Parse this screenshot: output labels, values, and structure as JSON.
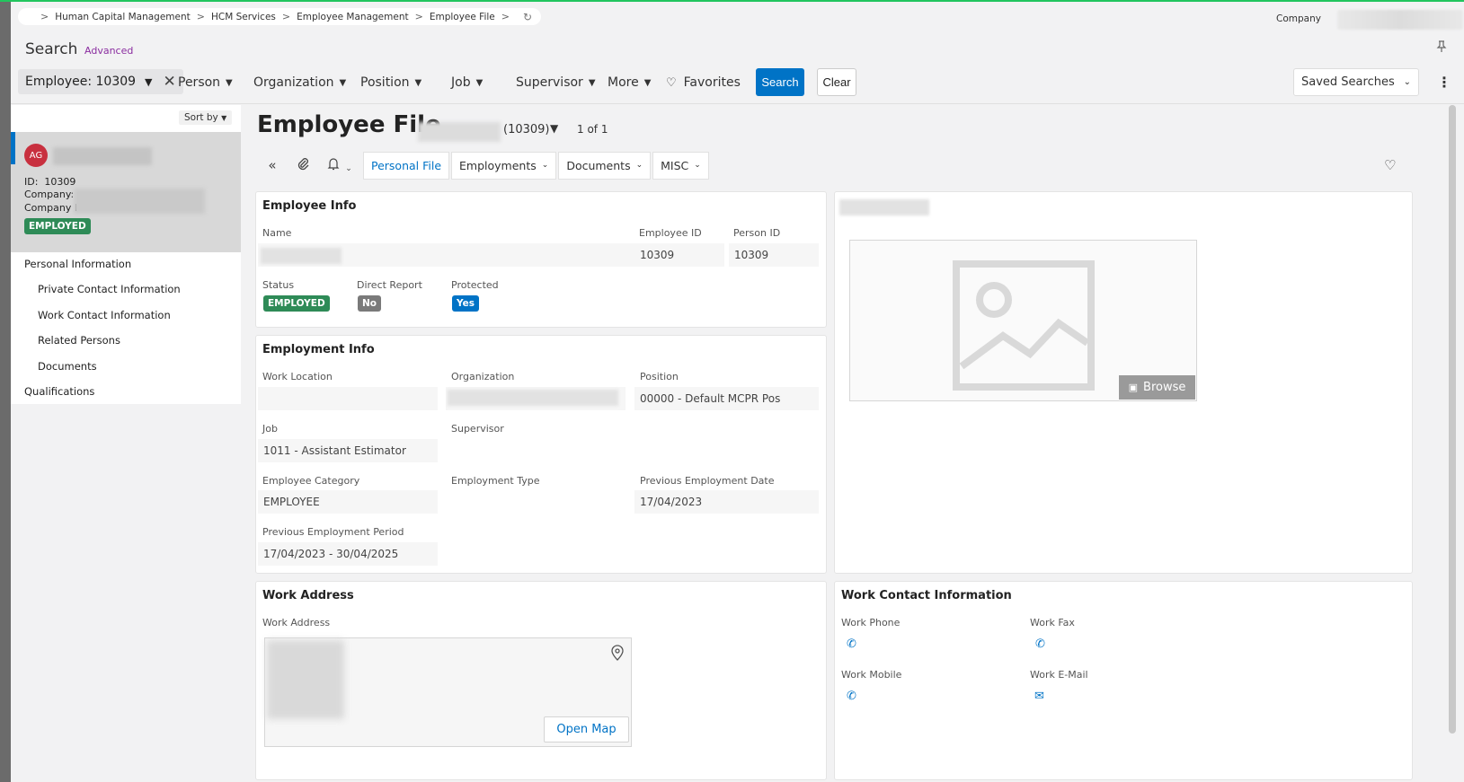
{
  "breadcrumb": {
    "items": [
      "Human Capital Management",
      "HCM Services",
      "Employee Management",
      "Employee File"
    ],
    "sep": ">",
    "refresh_icon": "↻"
  },
  "header": {
    "company_label": "Company"
  },
  "search": {
    "title": "Search",
    "advanced": "Advanced"
  },
  "filters": {
    "chip": "Employee: 10309",
    "person": "Person",
    "organization": "Organization",
    "position": "Position",
    "job": "Job",
    "supervisor": "Supervisor",
    "more": "More",
    "favorites": "Favorites",
    "search_btn": "Search",
    "clear_btn": "Clear",
    "saved_searches": "Saved Searches"
  },
  "sidebar": {
    "sort_by": "Sort by",
    "card": {
      "initials": "AG",
      "id_label": "ID:",
      "id_value": "10309",
      "company_label": "Company:",
      "company2_label": "Company I",
      "status": "EMPLOYED"
    },
    "nav": [
      {
        "label": "Personal Information"
      },
      {
        "label": "Private Contact Information"
      },
      {
        "label": "Work Contact Information"
      },
      {
        "label": "Related Persons"
      },
      {
        "label": "Documents"
      },
      {
        "label": "Qualifications"
      }
    ]
  },
  "main": {
    "title": "Employee File",
    "employee_number": "(10309)",
    "pager": "1 of 1",
    "tabs": {
      "personal_file": "Personal File",
      "employments": "Employments",
      "documents": "Documents",
      "misc": "MISC"
    }
  },
  "employee_info": {
    "title": "Employee Info",
    "name_label": "Name",
    "employee_id_label": "Employee ID",
    "employee_id": "10309",
    "person_id_label": "Person ID",
    "person_id": "10309",
    "status_label": "Status",
    "status": "EMPLOYED",
    "direct_report_label": "Direct Report",
    "direct_report": "No",
    "protected_label": "Protected",
    "protected": "Yes"
  },
  "employment_info": {
    "title": "Employment Info",
    "work_location_label": "Work Location",
    "organization_label": "Organization",
    "position_label": "Position",
    "position": "00000 - Default MCPR Pos",
    "job_label": "Job",
    "job": "1011 - Assistant Estimator",
    "supervisor_label": "Supervisor",
    "category_label": "Employee Category",
    "category": "EMPLOYEE",
    "type_label": "Employment Type",
    "prev_date_label": "Previous Employment Date",
    "prev_date": "17/04/2023",
    "prev_period_label": "Previous Employment Period",
    "prev_period": "17/04/2023 - 30/04/2025"
  },
  "photo": {
    "browse": "Browse"
  },
  "work_address": {
    "title": "Work Address",
    "label": "Work Address",
    "open_map": "Open Map"
  },
  "work_contact": {
    "title": "Work Contact Information",
    "phone_label": "Work Phone",
    "fax_label": "Work Fax",
    "mobile_label": "Work Mobile",
    "email_label": "Work E-Mail"
  },
  "colors": {
    "accent": "#0073c6",
    "employed": "#2e8b57",
    "avatar": "#c8303f"
  }
}
